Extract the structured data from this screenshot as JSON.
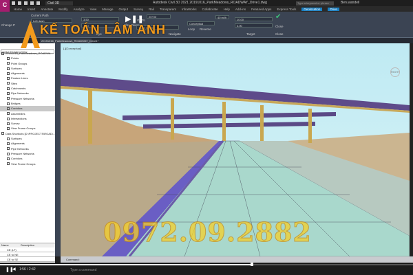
{
  "app": {
    "icon_label": "C",
    "icon_sub": "CIVIL",
    "title": "Autodesk Civil 3D 2021    20191016_ParkMeadows_ROADWAY_Drive1.dwg",
    "workspace": "Civil 3D",
    "search_placeholder": "Type a keyword or phrase",
    "user": "Ben.wandell"
  },
  "ribbon_tabs": [
    "Home",
    "Insert",
    "Annotate",
    "Modify",
    "Analyze",
    "View",
    "Manage",
    "Output",
    "Survey",
    "Rail",
    "Transparent",
    "InfraWorks",
    "Collaborate",
    "Help",
    "Add-ins",
    "Featured Apps",
    "Express Tools",
    "Geolocation",
    "Drive"
  ],
  "ribbon": {
    "change_profile": "Change P",
    "current_path_label": "Current Path",
    "current_path_value": "Left dash",
    "eye_label": "Eye",
    "eye_value1": "3.50",
    "eye_value2": "1.00",
    "play_pause": "Play Pause",
    "go_to_label": "Go To",
    "go_to_value": "20+00",
    "speed_value": "100% 50.00",
    "visual_style": "Conceptual",
    "loop": "Loop",
    "reverse": "Reverse",
    "navigate_label": "Navigate",
    "view_speed": "40 mi/h",
    "target_value1": "10.00",
    "target_value2": "4.00",
    "target_label": "Target",
    "close_label": "Close",
    "close_panel": "Close"
  },
  "document_tab": "20191016_ParkMeadows_ROADWAY_Drive1*",
  "palette": {
    "title": "TOOLSPACE",
    "view": "Active Drawing View",
    "tree": [
      {
        "label": "20191016_ParkMeadows_ROADWA...",
        "level": 0
      },
      {
        "label": "Points",
        "level": 1
      },
      {
        "label": "Point Groups",
        "level": 1
      },
      {
        "label": "Surfaces",
        "level": 1
      },
      {
        "label": "Alignments",
        "level": 1
      },
      {
        "label": "Feature Lines",
        "level": 1
      },
      {
        "label": "Sites",
        "level": 1
      },
      {
        "label": "Catchments",
        "level": 1
      },
      {
        "label": "Pipe Networks",
        "level": 1
      },
      {
        "label": "Pressure Networks",
        "level": 1
      },
      {
        "label": "Bridges",
        "level": 1
      },
      {
        "label": "Corridors",
        "level": 1,
        "selected": true
      },
      {
        "label": "Assemblies",
        "level": 1
      },
      {
        "label": "Intersections",
        "level": 1
      },
      {
        "label": "Survey",
        "level": 1
      },
      {
        "label": "View Frame Groups",
        "level": 1
      },
      {
        "label": "Data Shortcuts [D:\\PROJECTS\\ROAD\\...",
        "level": 0
      },
      {
        "label": "Surfaces",
        "level": 1
      },
      {
        "label": "Alignments",
        "level": 1
      },
      {
        "label": "Pipe Networks",
        "level": 1
      },
      {
        "label": "Pressure Networks",
        "level": 1
      },
      {
        "label": "Corridors",
        "level": 1
      },
      {
        "label": "View Frame Groups",
        "level": 1
      }
    ],
    "table_headers": [
      "Name",
      "Description"
    ],
    "table_rows": [
      "CE (LT)",
      "CE to NE",
      "CE to SE"
    ]
  },
  "viewport": {
    "label": "[-][Conceptual]",
    "viewcube": "RIGHT"
  },
  "command": {
    "label": "Command:",
    "placeholder": "Type a command"
  },
  "video": {
    "time": "1:56 / 2:42",
    "progress": 0.61
  },
  "watermark": {
    "logo_text": "KẾ TOÁN LÂM ANH",
    "phone": "0972.09.2882"
  },
  "colors": {
    "accent": "#1a7fc1",
    "app": "#a31d6e",
    "logo": "#f29a1c",
    "phone": "#f5d02a"
  }
}
